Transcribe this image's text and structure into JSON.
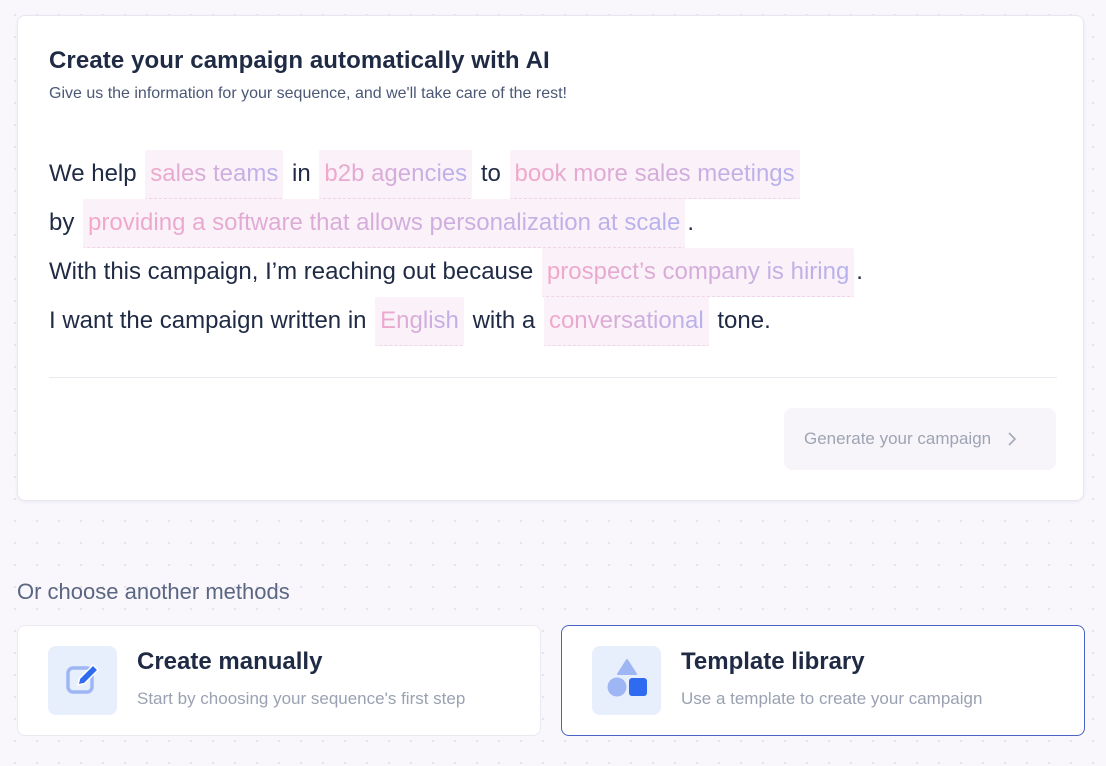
{
  "ai": {
    "title": "Create your campaign automatically with AI",
    "subtitle": "Give us the information for your sequence, and we'll take care of the rest!",
    "line1": {
      "t1": "We help",
      "p1": "sales teams",
      "t2": "in",
      "p2": "b2b agencies",
      "t3": "to",
      "p3": "book more sales meetings"
    },
    "line2": {
      "t1": "by",
      "p1": "providing a software that allows personalization at scale",
      "t2": "."
    },
    "line3": {
      "t1": "With this campaign, I’m reaching out because",
      "p1": "prospect’s company is hiring",
      "t2": "."
    },
    "line4": {
      "t1": "I want the campaign written in",
      "p1": "English",
      "t2": "with a",
      "p2": "conversational",
      "t3": "tone."
    },
    "generate_label": "Generate your campaign",
    "generate_icon": "chevron-right-icon"
  },
  "methods": {
    "heading": "Or choose another methods",
    "manual": {
      "title": "Create manually",
      "desc": "Start by choosing your sequence's first step",
      "icon": "edit-icon"
    },
    "template": {
      "title": "Template library",
      "desc": "Use a template to create your campaign",
      "icon": "shapes-icon"
    }
  },
  "colors": {
    "accent": "#4a63c4",
    "icon_blue": "#2f6bf0",
    "icon_light": "#9fb6f5",
    "chip_pink": "#f4a7c9",
    "chip_violet": "#b4b2ee"
  }
}
